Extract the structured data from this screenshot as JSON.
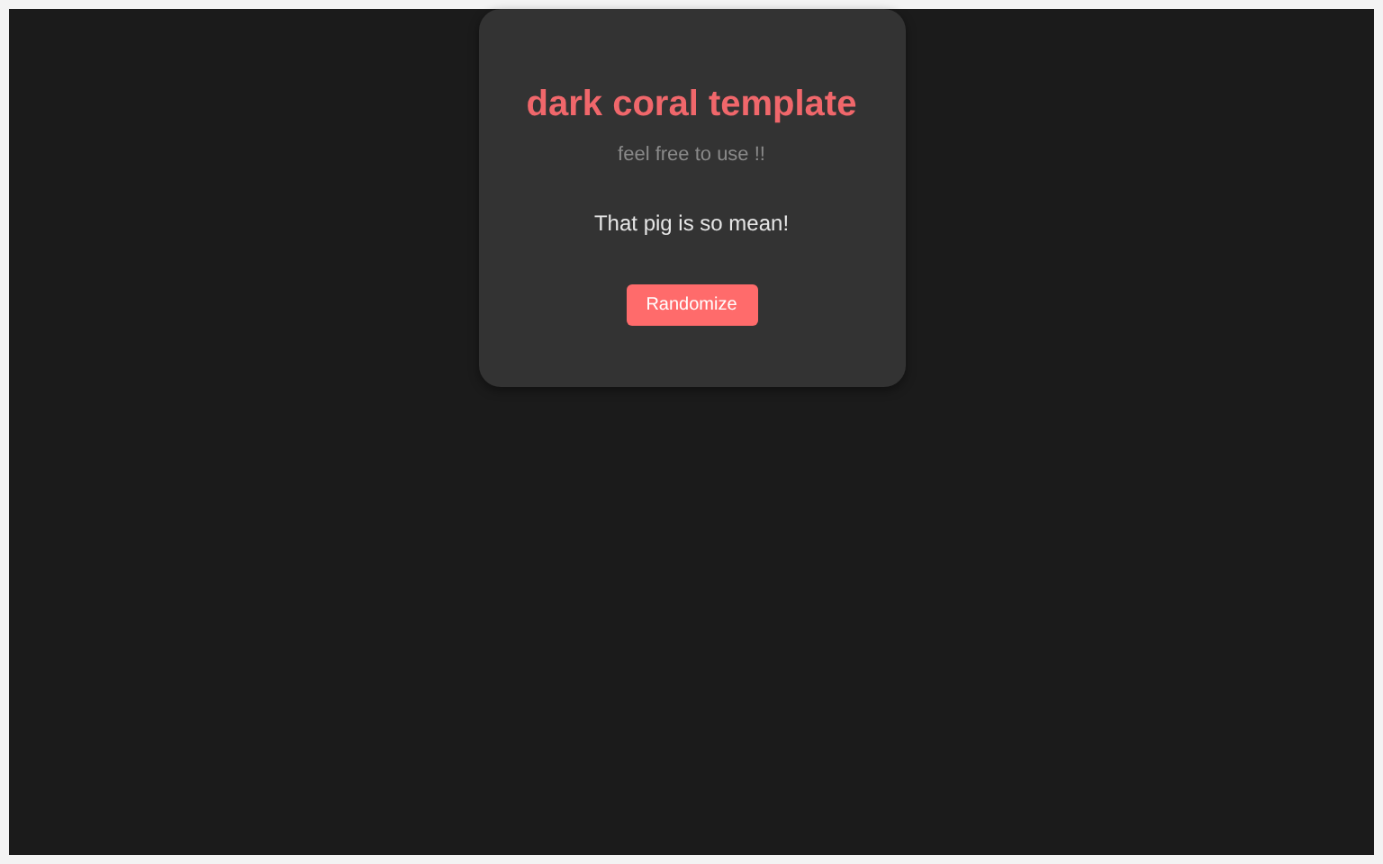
{
  "card": {
    "title": "dark coral template",
    "subtitle": "feel free to use !!",
    "message": "That pig is so mean!",
    "button": "Randomize"
  }
}
